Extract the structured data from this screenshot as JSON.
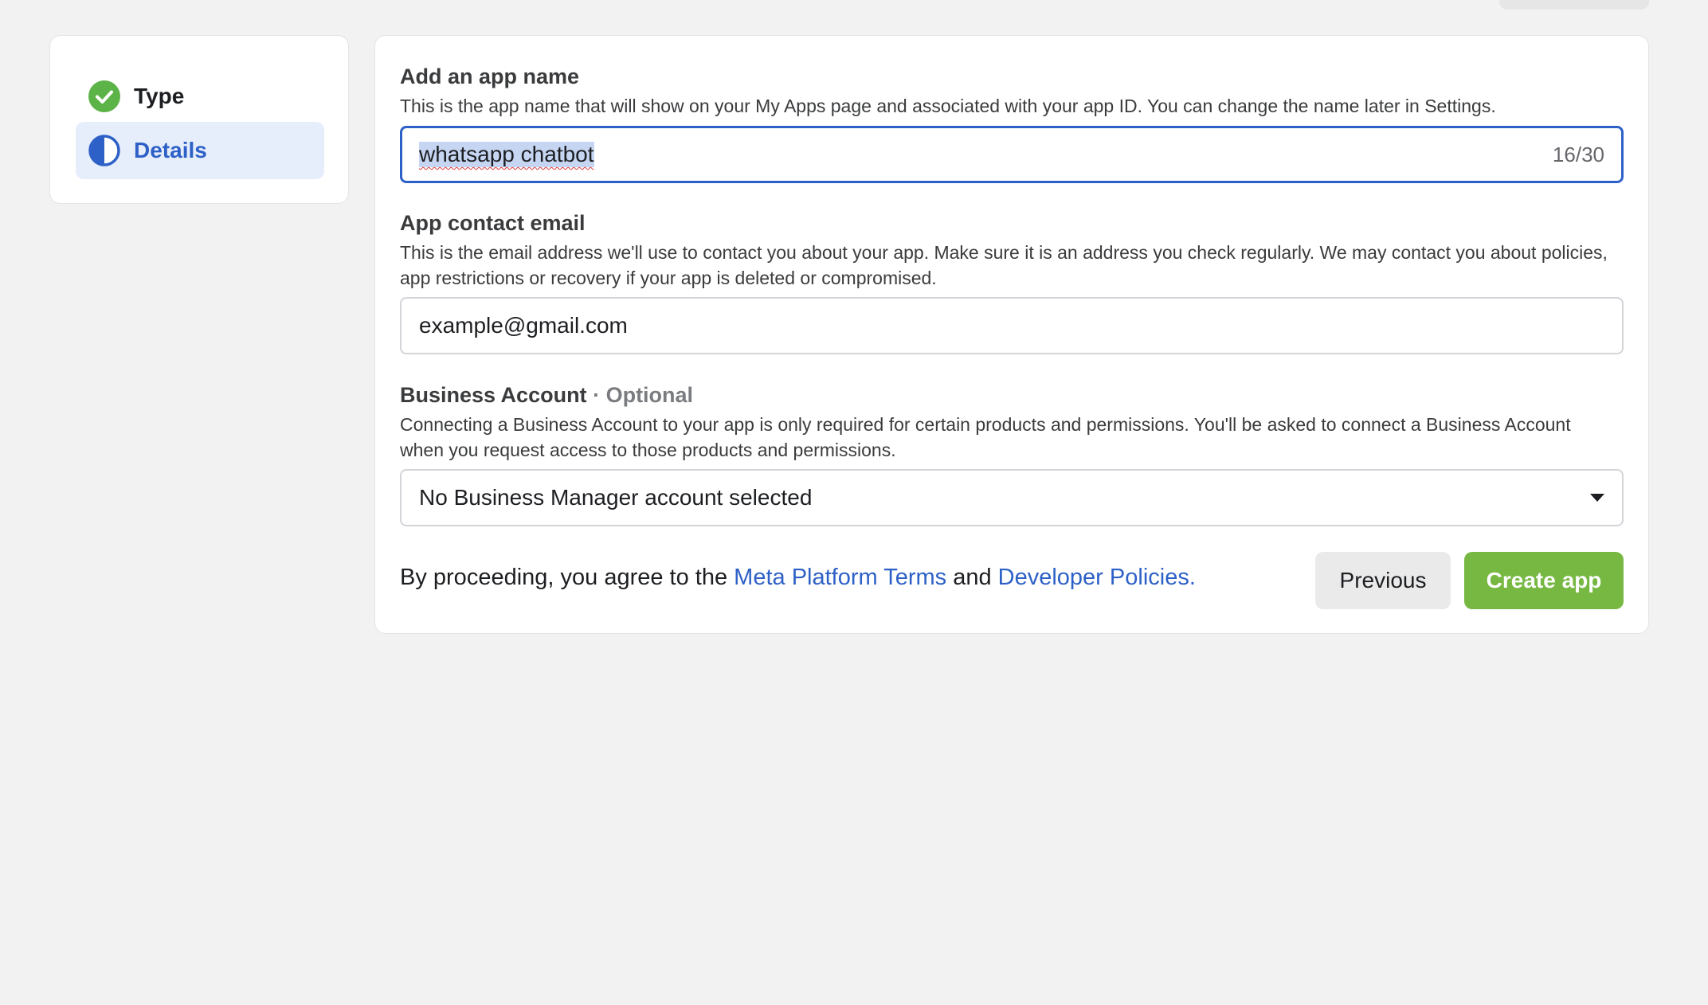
{
  "steps": {
    "items": [
      {
        "label": "Type",
        "status": "complete",
        "icon": "check-circle-icon"
      },
      {
        "label": "Details",
        "status": "in-progress",
        "icon": "half-circle-icon"
      }
    ]
  },
  "form": {
    "app_name": {
      "title": "Add an app name",
      "description": "This is the app name that will show on your My Apps page and associated with your app ID. You can change the name later in Settings.",
      "value": "whatsapp chatbot",
      "counter": "16/30"
    },
    "contact_email": {
      "title": "App contact email",
      "description": "This is the email address we'll use to contact you about your app. Make sure it is an address you check regularly. We may contact you about policies, app restrictions or recovery if your app is deleted or compromised.",
      "value": "example@gmail.com"
    },
    "business_account": {
      "title": "Business Account",
      "optional_label": "· Optional",
      "description": "Connecting a Business Account to your app is only required for certain products and permissions. You'll be asked to connect a Business Account when you request access to those products and permissions.",
      "selected": "No Business Manager account selected"
    }
  },
  "footer": {
    "prefix": "By proceeding, you agree to the ",
    "terms_link": "Meta Platform Terms",
    "and": " and ",
    "policies_link": "Developer Policies."
  },
  "buttons": {
    "previous": "Previous",
    "create": "Create app"
  },
  "colors": {
    "accent_blue": "#2e61c7",
    "success_green": "#5cb347",
    "create_button": "#77b843",
    "background": "#f2f2f2"
  }
}
